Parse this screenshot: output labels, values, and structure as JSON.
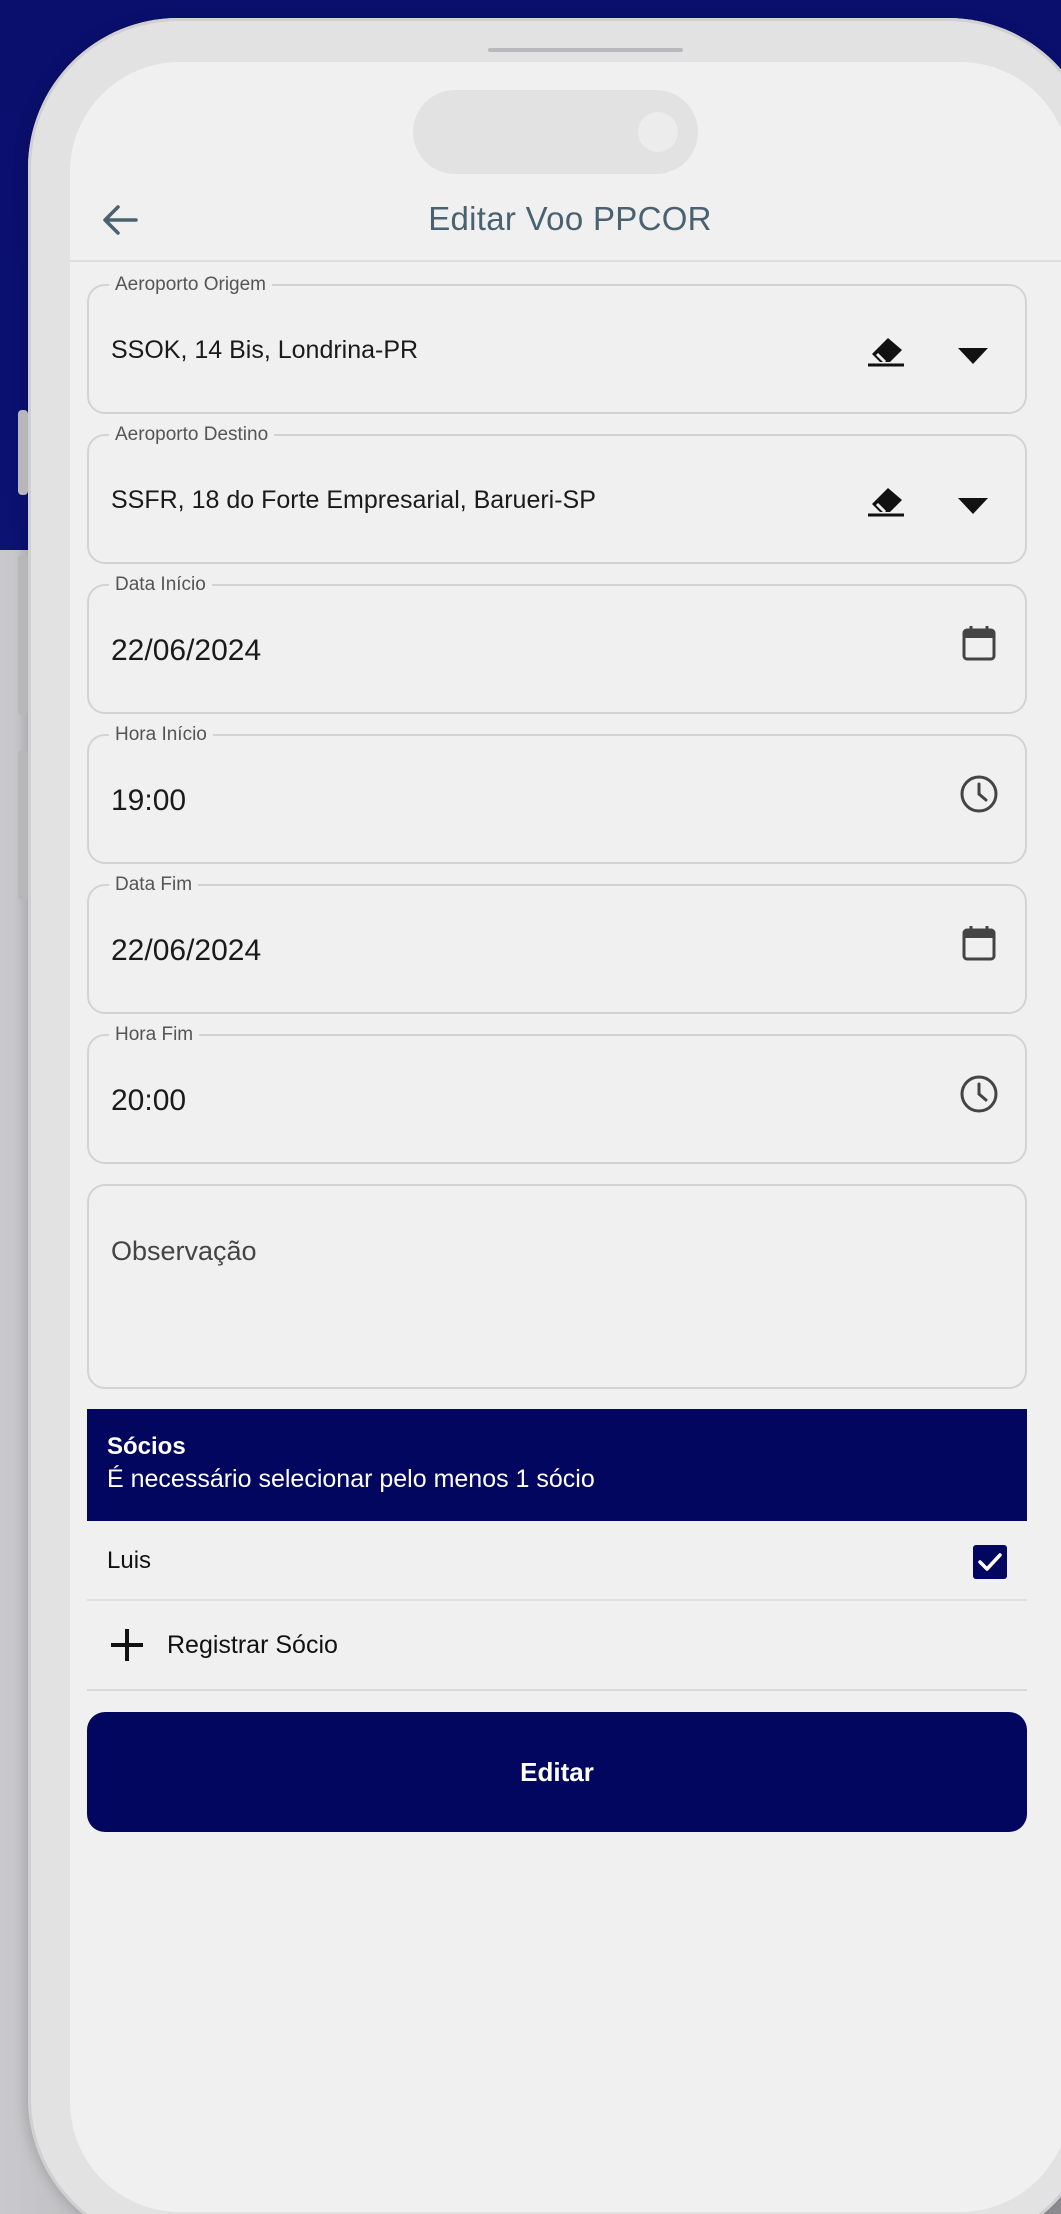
{
  "header": {
    "title": "Editar Voo PPCOR"
  },
  "form": {
    "origin": {
      "label": "Aeroporto Origem",
      "value": "SSOK, 14 Bis, Londrina-PR"
    },
    "destination": {
      "label": "Aeroporto Destino",
      "value": "SSFR, 18 do Forte Empresarial, Barueri-SP"
    },
    "start_date": {
      "label": "Data Início",
      "value": "22/06/2024"
    },
    "start_time": {
      "label": "Hora Início",
      "value": "19:00"
    },
    "end_date": {
      "label": "Data Fim",
      "value": "22/06/2024"
    },
    "end_time": {
      "label": "Hora Fim",
      "value": "20:00"
    },
    "observation": {
      "placeholder": "Observação"
    }
  },
  "socios": {
    "title": "Sócios",
    "subtitle": "É necessário selecionar pelo menos 1 sócio",
    "items": [
      {
        "name": "Luis",
        "checked": true
      }
    ],
    "register_label": "Registrar Sócio"
  },
  "actions": {
    "submit_label": "Editar"
  },
  "colors": {
    "primary": "#03065e",
    "background": "#f0f0f0",
    "title_text": "#4a6270"
  },
  "icons": {
    "back": "arrow-left-icon",
    "clear": "eraser-icon",
    "dropdown": "caret-down-icon",
    "calendar": "calendar-icon",
    "clock": "clock-icon",
    "checkbox": "check-icon",
    "add": "plus-icon"
  }
}
